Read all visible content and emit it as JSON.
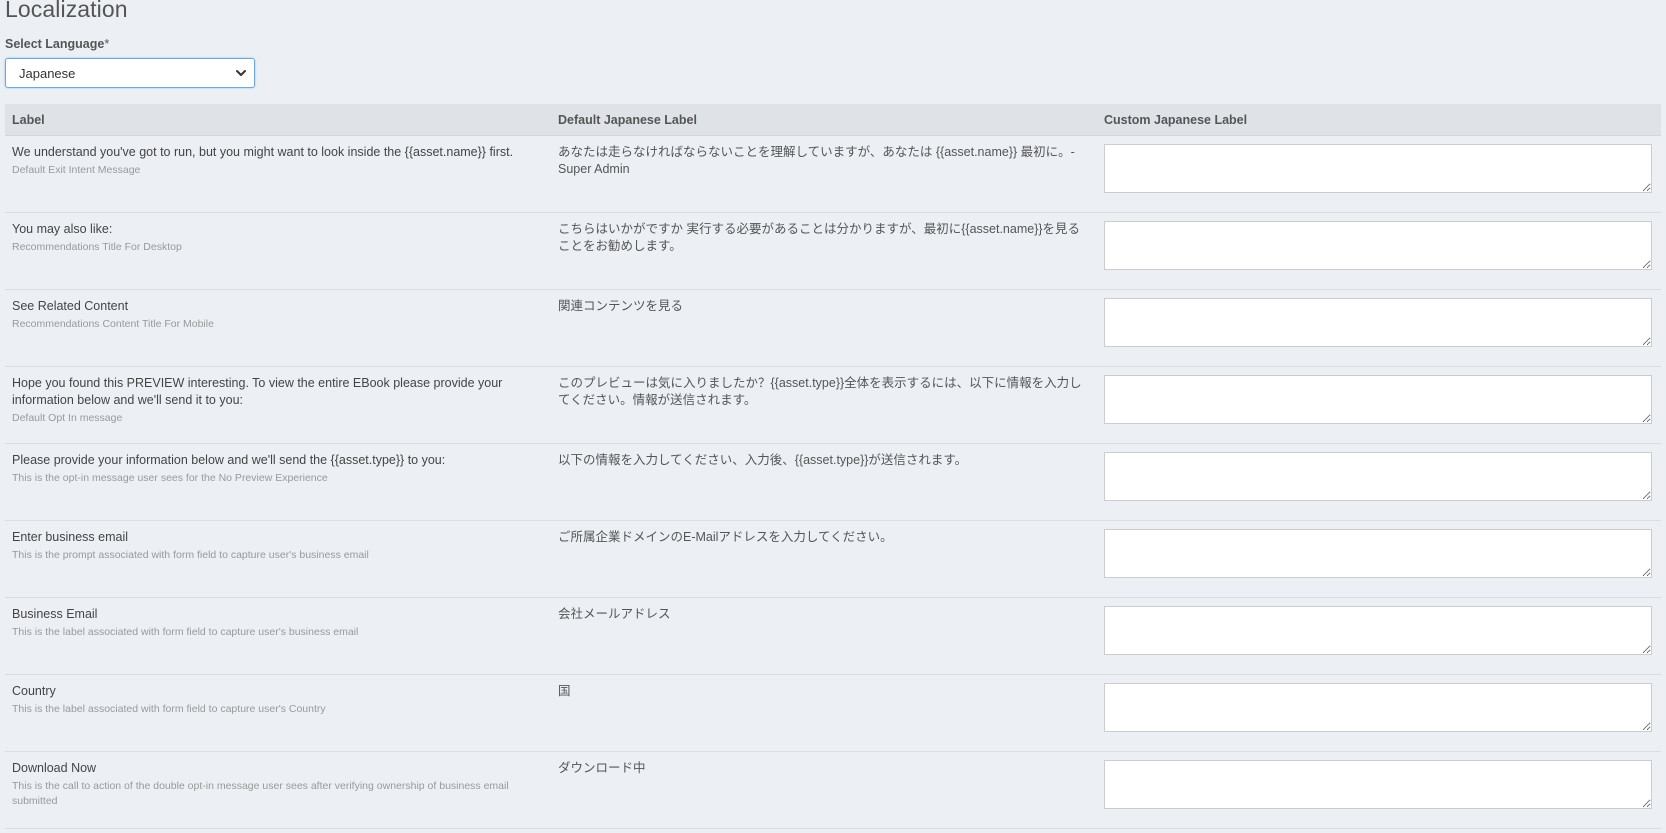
{
  "page": {
    "title": "Localization"
  },
  "language_select": {
    "label": "Select Language",
    "required_mark": "*",
    "value": "Japanese"
  },
  "table": {
    "headers": {
      "label": "Label",
      "default": "Default Japanese Label",
      "custom": "Custom Japanese Label"
    },
    "rows": [
      {
        "label": "We understand you've got to run, but you might want to look inside the {{asset.name}} first.",
        "description": "Default Exit Intent Message",
        "default": "あなたは走らなければならないことを理解していますが、あなたは {{asset.name}} 最初に。- Super Admin",
        "custom": ""
      },
      {
        "label": "You may also like:",
        "description": "Recommendations Title For Desktop",
        "default": "こちらはいかがですか 実行する必要があることは分かりますが、最初に{{asset.name}}を見ることをお勧めします。",
        "custom": ""
      },
      {
        "label": "See Related Content",
        "description": "Recommendations Content Title For Mobile",
        "default": "関連コンテンツを見る",
        "custom": ""
      },
      {
        "label": "Hope you found this PREVIEW interesting. To view the entire EBook please provide your information below and we'll send it to you:",
        "description": "Default Opt In message",
        "default": "このプレビューは気に入りましたか？{{asset.type}}全体を表示するには、以下に情報を入力してください。情報が送信されます。",
        "custom": ""
      },
      {
        "label": "Please provide your information below and we'll send the {{asset.type}} to you:",
        "description": "This is the opt-in message user sees for the No Preview Experience",
        "default": "以下の情報を入力してください、入力後、{{asset.type}}が送信されます。",
        "custom": ""
      },
      {
        "label": "Enter business email",
        "description": "This is the prompt associated with form field to capture user's business email",
        "default": "ご所属企業ドメインのE-Mailアドレスを入力してください。",
        "custom": ""
      },
      {
        "label": "Business Email",
        "description": "This is the label associated with form field to capture user's business email",
        "default": "会社メールアドレス",
        "custom": ""
      },
      {
        "label": "Country",
        "description": "This is the label associated with form field to capture user's Country",
        "default": "国",
        "custom": ""
      },
      {
        "label": "Download Now",
        "description": "This is the call to action of the double opt-in message user sees after verifying ownership of business email submitted",
        "default": "ダウンロード中",
        "custom": ""
      }
    ]
  },
  "icons": {
    "select_chevron": "chevron-down-icon"
  },
  "colors": {
    "background": "#ecf0f5",
    "header_row": "#dfe3e8",
    "select_border": "#6fa8dc"
  }
}
